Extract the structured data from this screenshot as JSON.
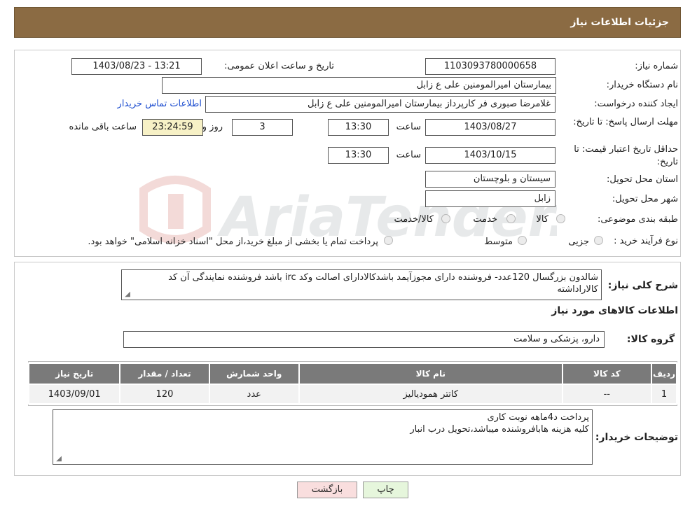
{
  "header": {
    "title": "جزئیات اطلاعات نیاز"
  },
  "fields": {
    "need_number_label": "شماره نیاز:",
    "need_number": "1103093780000658",
    "announce_label": "تاریخ و ساعت اعلان عمومی:",
    "announce_value": "1403/08/23 - 13:21",
    "buyer_label": "نام دستگاه خریدار:",
    "buyer_value": "بیمارستان امیرالمومنین علی  ع  زابل",
    "creator_label": "ایجاد کننده درخواست:",
    "creator_value": "غلامرضا صبوری فر کارپرداز بیمارستان امیرالمومنین علی  ع  زابل",
    "contact_link": "اطلاعات تماس خریدار",
    "reply_deadline_label": "مهلت ارسال پاسخ: تا تاریخ:",
    "reply_date": "1403/08/27",
    "time_label": "ساعت",
    "reply_time": "13:30",
    "days_value": "3",
    "days_label": "روز و",
    "remaining_time": "23:24:59",
    "remaining_label": "ساعت باقی مانده",
    "validity_label": "حداقل تاریخ اعتبار قیمت: تا تاریخ:",
    "validity_date": "1403/10/15",
    "validity_time": "13:30",
    "province_label": "استان محل تحویل:",
    "province_value": "سیستان و بلوچستان",
    "city_label": "شهر محل تحویل:",
    "city_value": "زابل",
    "category_label": "طبقه بندی موضوعی:",
    "category_options": [
      "کالا",
      "خدمت",
      "کالا/خدمت"
    ],
    "process_label": "نوع فرآیند خرید :",
    "process_options": [
      "جزیی",
      "متوسط"
    ],
    "process_note": "پرداخت تمام یا بخشی از مبلغ خرید،از محل \"اسناد خزانه اسلامی\" خواهد بود."
  },
  "description": {
    "label": "شرح کلی نیاز:",
    "value": "شالدون بزرگسال 120عدد- فروشنده دارای مجوزآیمد باشدکالادارای اصالت وکد irc باشد فروشنده نمایندگی آن کد کالاراداشته"
  },
  "goods": {
    "section_title": "اطلاعات کالاهای مورد نیاز",
    "group_label": "گروه کالا:",
    "group_value": "دارو، پزشکی و سلامت",
    "columns": [
      "ردیف",
      "کد کالا",
      "نام کالا",
      "واحد شمارش",
      "تعداد / مقدار",
      "تاریخ نیاز"
    ],
    "rows": [
      [
        "1",
        "--",
        "کاتتر همودیالیز",
        "عدد",
        "120",
        "1403/09/01"
      ]
    ]
  },
  "buyer_notes": {
    "label": "توضیحات خریدار:",
    "line1": "پرداخت د4ماهه نوبت کاری",
    "line2": "کلیه هزینه هابافروشنده میباشد،تحویل درب انبار"
  },
  "buttons": {
    "print": "چاپ",
    "back": "بازگشت"
  },
  "watermark": {
    "text": "AriaTender.neT"
  },
  "colors": {
    "header": "#8b6b43",
    "link": "#1f4fd0",
    "remaining_bg": "#f7f1c6",
    "back_bg": "#f9dede",
    "print_bg": "#e6f6dc"
  }
}
